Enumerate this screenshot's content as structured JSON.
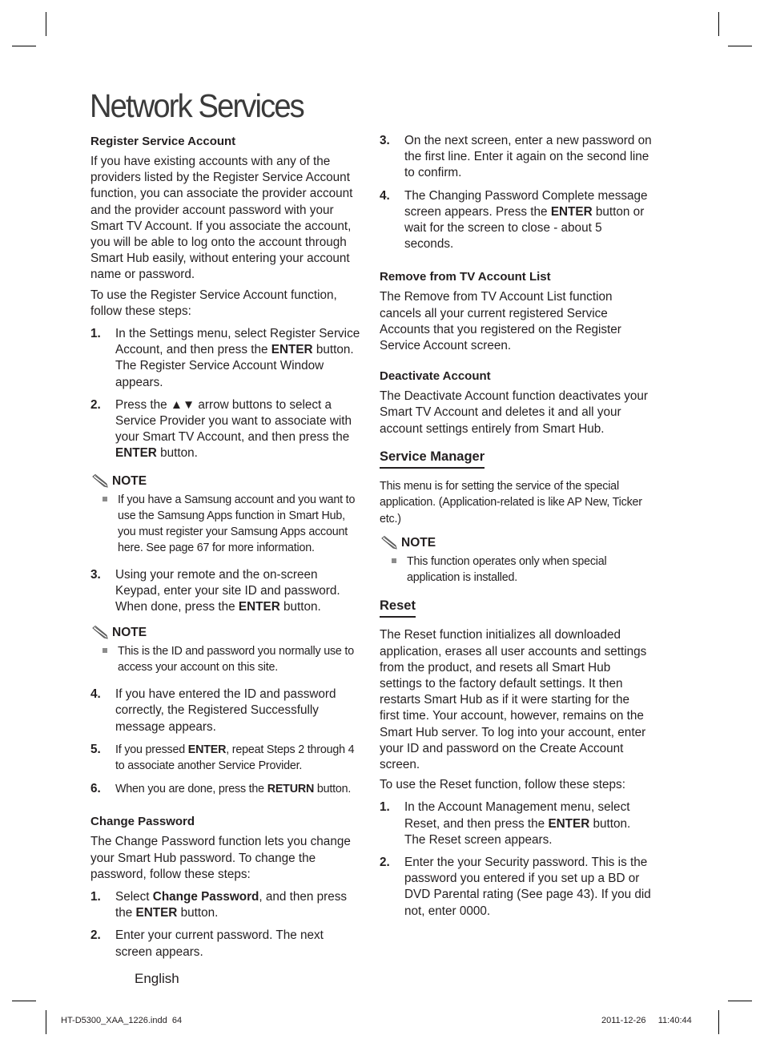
{
  "page": {
    "title": "Network Services",
    "footer_language": "English",
    "slug_file": "HT-D5300_XAA_1226.indd",
    "slug_page": "64",
    "slug_date": "2011-12-26",
    "slug_time": "11:40:44"
  },
  "left": {
    "register": {
      "heading": "Register Service Account",
      "intro": "If you have existing accounts with any of the providers listed by the Register Service Account function, you can associate the provider account and the provider account password with your Smart TV Account. If you associate the account, you will be able to log onto the account through Smart Hub easily, without entering your account name or password.",
      "lead": "To use the Register Service Account function, follow these steps:",
      "steps": [
        {
          "num": "1.",
          "pre": "In the Settings menu, select Register Service Account, and then press the ",
          "bold": "ENTER",
          "post": " button. The Register Service Account Window appears."
        },
        {
          "num": "2.",
          "pre": "Press the ▲▼ arrow buttons to select a Service Provider you want to associate with your Smart TV Account, and then press the ",
          "bold": "ENTER",
          "post": " button."
        }
      ],
      "note1": {
        "label": "NOTE",
        "text": "If you have a Samsung account and you want to use the Samsung Apps function in Smart Hub, you must register your Samsung Apps account here. See page 67 for more information."
      },
      "step3": {
        "num": "3.",
        "pre": "Using your remote and the on-screen Keypad, enter your site ID and password. When done, press the ",
        "bold": "ENTER",
        "post": " button."
      },
      "note2": {
        "label": "NOTE",
        "text": "This is the ID and password you normally use to access your account on this site."
      },
      "step4": {
        "num": "4.",
        "text": "If you have entered the ID and password correctly, the Registered Successfully message appears."
      },
      "step5": {
        "num": "5.",
        "pre": "If you pressed ",
        "bold": "ENTER",
        "post": ", repeat Steps 2 through 4 to associate another Service Provider."
      },
      "step6": {
        "num": "6.",
        "pre": "When you are done, press the ",
        "bold": "RETURN",
        "post": " button."
      }
    },
    "change_password": {
      "heading": "Change Password",
      "intro": "The Change Password function lets you change your Smart Hub password. To change the password, follow these steps:",
      "step1": {
        "num": "1.",
        "pre": "Select ",
        "bold1": "Change Password",
        "mid": ", and then press the ",
        "bold2": "ENTER",
        "post": " button."
      },
      "step2": {
        "num": "2.",
        "text": "Enter your current password. The next screen appears."
      }
    }
  },
  "right": {
    "change_password_cont": {
      "step3": {
        "num": "3.",
        "text": "On the next screen, enter a new password on the first line. Enter it again on the second line to confirm."
      },
      "step4": {
        "num": "4.",
        "pre": "The Changing Password Complete message screen appears. Press the ",
        "bold": "ENTER",
        "post": " button or wait for the screen to close - about 5 seconds."
      }
    },
    "remove": {
      "heading": "Remove from TV Account List",
      "text": "The Remove from TV Account List function cancels all your current registered Service Accounts that you registered on the Register Service Account screen."
    },
    "deactivate": {
      "heading": "Deactivate Account",
      "text": "The Deactivate Account function deactivates your Smart TV Account and deletes it and all your account settings entirely from Smart Hub."
    },
    "service_manager": {
      "heading": "Service Manager",
      "text": "This menu is for setting the service of the special application. (Application-related is like AP New, Ticker etc.)",
      "note": {
        "label": "NOTE",
        "text": "This function operates only when special application is installed."
      }
    },
    "reset": {
      "heading": "Reset",
      "text": "The Reset function initializes all downloaded application, erases all user accounts and settings from the product, and resets all Smart Hub settings to the factory default settings. It then restarts Smart Hub as if it were starting for the first time. Your account, however, remains on the Smart Hub server. To log into your account, enter your ID and password on the Create Account screen.",
      "lead": "To use the Reset function, follow these steps:",
      "step1": {
        "num": "1.",
        "pre": "In the Account Management menu, select Reset, and then press the ",
        "bold": "ENTER",
        "post": " button. The Reset screen appears."
      },
      "step2": {
        "num": "2.",
        "text": "Enter the your Security password. This is the password you entered if you set up a BD or DVD Parental rating (See page 43). If you did not, enter 0000."
      }
    }
  }
}
